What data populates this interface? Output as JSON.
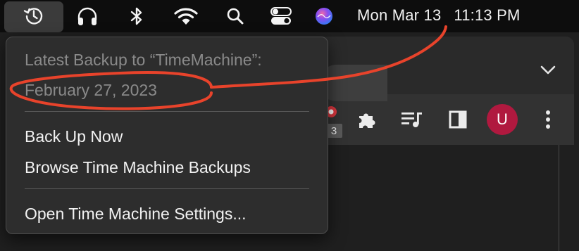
{
  "menubar": {
    "icons": [
      "time-machine-icon",
      "headphones-icon",
      "bluetooth-icon",
      "wifi-icon",
      "spotlight-search-icon",
      "control-center-icon",
      "siri-icon"
    ],
    "clock": {
      "date": "Mon Mar 13",
      "time": "11:13 PM"
    }
  },
  "time_machine_menu": {
    "latest_backup_label": "Latest Backup to “TimeMachine”:",
    "latest_backup_date": "February 27, 2023",
    "items": {
      "back_up_now": "Back Up Now",
      "browse_backups": "Browse Time Machine Backups",
      "open_settings": "Open Time Machine Settings..."
    }
  },
  "browser": {
    "extension_badge": "3",
    "avatar_letter": "U",
    "icons": [
      "extensions-puzzle-icon",
      "media-queue-icon",
      "side-panel-icon",
      "more-vertical-icon",
      "tab-search-chevron-icon"
    ]
  },
  "annotation": {
    "color": "#e8432b"
  },
  "colors": {
    "menubar_bg": "#0d0d0d",
    "menu_bg": "#2d2d2d",
    "avatar": "#b0193f",
    "siri_gradient": [
      "#3a8ef6",
      "#b04cf0",
      "#f04a7a"
    ]
  }
}
